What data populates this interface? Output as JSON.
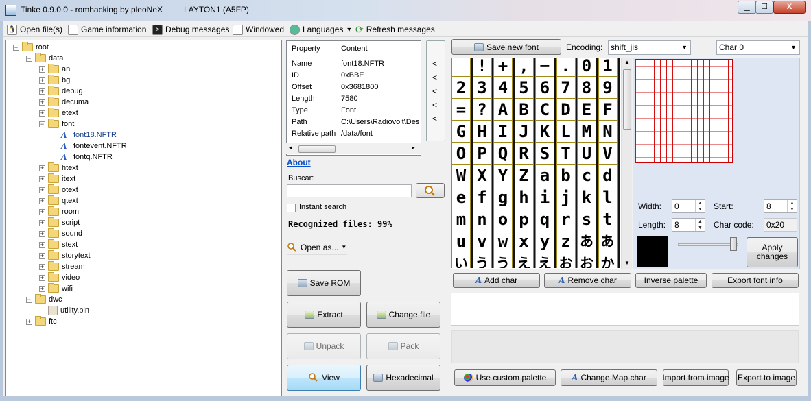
{
  "window": {
    "title": "Tinke 0.9.0.0 - romhacking by pleoNeX",
    "rom": "LAYTON1 (A5FP)",
    "min_label": "▁",
    "max_label": "☐",
    "close_label": "X"
  },
  "toolbar": {
    "open_files": "Open file(s)",
    "game_info": "Game information",
    "debug": "Debug messages",
    "windowed": "Windowed",
    "languages": "Languages",
    "refresh": "Refresh messages"
  },
  "tree": [
    {
      "label": "root",
      "level": 0,
      "toggle": "−",
      "type": "folder"
    },
    {
      "label": "data",
      "level": 1,
      "toggle": "−",
      "type": "folder"
    },
    {
      "label": "ani",
      "level": 2,
      "toggle": "+",
      "type": "folder"
    },
    {
      "label": "bg",
      "level": 2,
      "toggle": "+",
      "type": "folder"
    },
    {
      "label": "debug",
      "level": 2,
      "toggle": "+",
      "type": "folder"
    },
    {
      "label": "decuma",
      "level": 2,
      "toggle": "+",
      "type": "folder"
    },
    {
      "label": "etext",
      "level": 2,
      "toggle": "+",
      "type": "folder"
    },
    {
      "label": "font",
      "level": 2,
      "toggle": "−",
      "type": "folder"
    },
    {
      "label": "font18.NFTR",
      "level": 3,
      "toggle": "",
      "type": "font",
      "selected": true
    },
    {
      "label": "fontevent.NFTR",
      "level": 3,
      "toggle": "",
      "type": "font"
    },
    {
      "label": "fontq.NFTR",
      "level": 3,
      "toggle": "",
      "type": "font"
    },
    {
      "label": "htext",
      "level": 2,
      "toggle": "+",
      "type": "folder"
    },
    {
      "label": "itext",
      "level": 2,
      "toggle": "+",
      "type": "folder"
    },
    {
      "label": "otext",
      "level": 2,
      "toggle": "+",
      "type": "folder"
    },
    {
      "label": "qtext",
      "level": 2,
      "toggle": "+",
      "type": "folder"
    },
    {
      "label": "room",
      "level": 2,
      "toggle": "+",
      "type": "folder"
    },
    {
      "label": "script",
      "level": 2,
      "toggle": "+",
      "type": "folder"
    },
    {
      "label": "sound",
      "level": 2,
      "toggle": "+",
      "type": "folder"
    },
    {
      "label": "stext",
      "level": 2,
      "toggle": "+",
      "type": "folder"
    },
    {
      "label": "storytext",
      "level": 2,
      "toggle": "+",
      "type": "folder"
    },
    {
      "label": "stream",
      "level": 2,
      "toggle": "+",
      "type": "folder"
    },
    {
      "label": "video",
      "level": 2,
      "toggle": "+",
      "type": "folder"
    },
    {
      "label": "wifi",
      "level": 2,
      "toggle": "+",
      "type": "folder"
    },
    {
      "label": "dwc",
      "level": 1,
      "toggle": "−",
      "type": "folder"
    },
    {
      "label": "utility.bin",
      "level": 2,
      "toggle": "",
      "type": "bin"
    },
    {
      "label": "ftc",
      "level": 1,
      "toggle": "+",
      "type": "folder"
    }
  ],
  "properties": {
    "header": {
      "property": "Property",
      "content": "Content"
    },
    "rows": [
      {
        "property": "Name",
        "content": "font18.NFTR"
      },
      {
        "property": "ID",
        "content": "0xBBE"
      },
      {
        "property": "Offset",
        "content": "0x3681800"
      },
      {
        "property": "Length",
        "content": "7580"
      },
      {
        "property": "Type",
        "content": "Font"
      },
      {
        "property": "Path",
        "content": "C:\\Users\\Radiovolt\\Des"
      },
      {
        "property": "Relative path",
        "content": "/data/font"
      }
    ]
  },
  "arrows": [
    "<",
    "<",
    "<",
    "<",
    "<"
  ],
  "left_panel": {
    "about": "About",
    "buscar": "Buscar:",
    "instant_search": "Instant search",
    "recognized": "Recognized files: 99%",
    "open_as": "Open as...",
    "save_rom": "Save ROM",
    "extract": "Extract",
    "change_file": "Change file",
    "unpack": "Unpack",
    "pack": "Pack",
    "view": "View",
    "hexadecimal": "Hexadecimal"
  },
  "font_editor": {
    "save_new_font": "Save new font",
    "encoding_label": "Encoding:",
    "encoding_value": "shift_jis",
    "char_value": "Char 0",
    "glyphs": [
      "",
      "!",
      "+",
      ",",
      "−",
      ".",
      "0",
      "1",
      "2",
      "3",
      "4",
      "5",
      "6",
      "7",
      "8",
      "9",
      "=",
      "?",
      "A",
      "B",
      "C",
      "D",
      "E",
      "F",
      "G",
      "H",
      "I",
      "J",
      "K",
      "L",
      "M",
      "N",
      "O",
      "P",
      "Q",
      "R",
      "S",
      "T",
      "U",
      "V",
      "W",
      "X",
      "Y",
      "Z",
      "a",
      "b",
      "c",
      "d",
      "e",
      "f",
      "g",
      "h",
      "i",
      "j",
      "k",
      "l",
      "m",
      "n",
      "o",
      "p",
      "q",
      "r",
      "s",
      "t",
      "u",
      "v",
      "w",
      "x",
      "y",
      "z",
      "あ",
      "あ",
      "い",
      "う",
      "う",
      "え",
      "え",
      "お",
      "お",
      "か"
    ],
    "width_label": "Width:",
    "width_value": "0",
    "start_label": "Start:",
    "start_value": "8",
    "length_label": "Length:",
    "length_value": "8",
    "char_code_label": "Char code:",
    "char_code_value": "0x20",
    "apply_changes": "Apply changes",
    "add_char": "Add char",
    "remove_char": "Remove char",
    "inverse_palette": "Inverse palette",
    "export_font_info": "Export font info",
    "use_custom_palette": "Use custom palette",
    "change_map_char": "Change Map char",
    "import_from_image": "Import from image",
    "export_to_image": "Export to image"
  }
}
